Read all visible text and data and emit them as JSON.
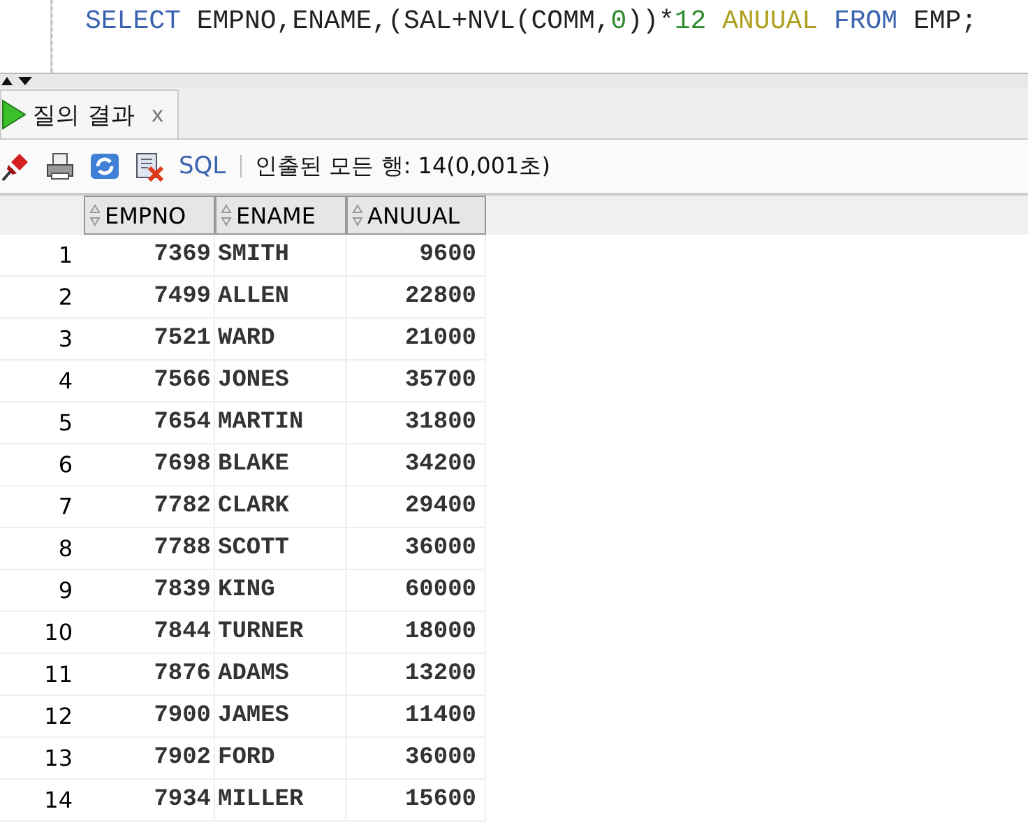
{
  "editor": {
    "tokens": [
      {
        "text": "SELECT",
        "kind": "keyword"
      },
      {
        "text": " EMPNO,ENAME,(SAL+NVL(COMM,",
        "kind": "ident"
      },
      {
        "text": "0",
        "kind": "number"
      },
      {
        "text": "))*",
        "kind": "ident"
      },
      {
        "text": "12",
        "kind": "number"
      },
      {
        "text": " ANUUAL",
        "kind": "alias"
      },
      {
        "text": " FROM",
        "kind": "keyword"
      },
      {
        "text": " EMP;",
        "kind": "ident"
      }
    ]
  },
  "tab": {
    "label": "질의 결과",
    "close": "x",
    "selected": true
  },
  "toolbar": {
    "sql_link": "SQL",
    "status": "인출된 모든 행: 14(0,001초)"
  },
  "table": {
    "columns": [
      "EMPNO",
      "ENAME",
      "ANUUAL"
    ],
    "rows": [
      {
        "row_number": "1",
        "cells": [
          "7369",
          "SMITH",
          "9600"
        ]
      },
      {
        "row_number": "2",
        "cells": [
          "7499",
          "ALLEN",
          "22800"
        ]
      },
      {
        "row_number": "3",
        "cells": [
          "7521",
          "WARD",
          "21000"
        ]
      },
      {
        "row_number": "4",
        "cells": [
          "7566",
          "JONES",
          "35700"
        ]
      },
      {
        "row_number": "5",
        "cells": [
          "7654",
          "MARTIN",
          "31800"
        ]
      },
      {
        "row_number": "6",
        "cells": [
          "7698",
          "BLAKE",
          "34200"
        ]
      },
      {
        "row_number": "7",
        "cells": [
          "7782",
          "CLARK",
          "29400"
        ]
      },
      {
        "row_number": "8",
        "cells": [
          "7788",
          "SCOTT",
          "36000"
        ]
      },
      {
        "row_number": "9",
        "cells": [
          "7839",
          "KING",
          "60000"
        ]
      },
      {
        "row_number": "10",
        "cells": [
          "7844",
          "TURNER",
          "18000"
        ]
      },
      {
        "row_number": "11",
        "cells": [
          "7876",
          "ADAMS",
          "13200"
        ]
      },
      {
        "row_number": "12",
        "cells": [
          "7900",
          "JAMES",
          "11400"
        ]
      },
      {
        "row_number": "13",
        "cells": [
          "7902",
          "FORD",
          "36000"
        ]
      },
      {
        "row_number": "14",
        "cells": [
          "7934",
          "MILLER",
          "15600"
        ]
      }
    ]
  }
}
